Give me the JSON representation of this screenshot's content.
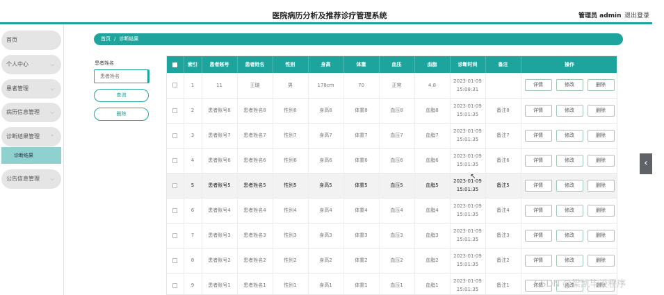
{
  "header": {
    "title": "医院病历分析及推荐诊疗管理系统",
    "admin": "管理员 admin",
    "logout": "退出登录"
  },
  "sidebar": {
    "items": [
      {
        "label": "首页"
      },
      {
        "label": "个人中心"
      },
      {
        "label": "患者管理"
      },
      {
        "label": "病历信息管理"
      },
      {
        "label": "诊断结果管理"
      },
      {
        "label": "公告信息管理"
      }
    ],
    "submenu": "诊断结果"
  },
  "breadcrumb": {
    "home": "首页",
    "sep": "/",
    "current": "诊断结果"
  },
  "search": {
    "label": "患者姓名",
    "placeholder": "患者姓名",
    "query_button": "查询",
    "delete_button": "删除"
  },
  "table": {
    "headers": [
      "索引",
      "患者账号",
      "患者姓名",
      "性别",
      "身高",
      "体重",
      "血压",
      "血脂",
      "诊断时间",
      "备注",
      "操作"
    ],
    "rows": [
      {
        "index": "1",
        "account": "11",
        "name": "王瑞",
        "gender": "男",
        "height": "178cm",
        "weight": "70",
        "bp": "正常",
        "lipid": "4.8",
        "date": "2023-01-09",
        "time": "15:08:31",
        "note": ""
      },
      {
        "index": "2",
        "account": "患者账号8",
        "name": "患者姓名8",
        "gender": "性别8",
        "height": "身高8",
        "weight": "体重8",
        "bp": "血压8",
        "lipid": "血脂8",
        "date": "2023-01-09",
        "time": "15:01:35",
        "note": "备注8"
      },
      {
        "index": "3",
        "account": "患者账号7",
        "name": "患者姓名7",
        "gender": "性别7",
        "height": "身高7",
        "weight": "体重7",
        "bp": "血压7",
        "lipid": "血脂7",
        "date": "2023-01-09",
        "time": "15:01:35",
        "note": "备注7"
      },
      {
        "index": "4",
        "account": "患者账号6",
        "name": "患者姓名6",
        "gender": "性别6",
        "height": "身高6",
        "weight": "体重6",
        "bp": "血压6",
        "lipid": "血脂6",
        "date": "2023-01-09",
        "time": "15:01:35",
        "note": "备注6"
      },
      {
        "index": "5",
        "account": "患者账号5",
        "name": "患者姓名5",
        "gender": "性别5",
        "height": "身高5",
        "weight": "体重5",
        "bp": "血压5",
        "lipid": "血脂5",
        "date": "2023-01-09",
        "time": "15:01:35",
        "note": "备注5"
      },
      {
        "index": "6",
        "account": "患者账号4",
        "name": "患者姓名4",
        "gender": "性别4",
        "height": "身高4",
        "weight": "体重4",
        "bp": "血压4",
        "lipid": "血脂4",
        "date": "2023-01-09",
        "time": "15:01:35",
        "note": "备注4"
      },
      {
        "index": "7",
        "account": "患者账号3",
        "name": "患者姓名3",
        "gender": "性别3",
        "height": "身高3",
        "weight": "体重3",
        "bp": "血压3",
        "lipid": "血脂3",
        "date": "2023-01-09",
        "time": "15:01:35",
        "note": "备注3"
      },
      {
        "index": "8",
        "account": "患者账号2",
        "name": "患者姓名2",
        "gender": "性别2",
        "height": "身高2",
        "weight": "体重2",
        "bp": "血压2",
        "lipid": "血脂2",
        "date": "2023-01-09",
        "time": "15:01:35",
        "note": "备注2"
      },
      {
        "index": "9",
        "account": "患者账号1",
        "name": "患者姓名1",
        "gender": "性别1",
        "height": "身高1",
        "weight": "体重1",
        "bp": "血压1",
        "lipid": "血脂1",
        "date": "2023-01-09",
        "time": "15:01:35",
        "note": "备注1"
      }
    ],
    "actions": {
      "detail": "详情",
      "edit": "修改",
      "delete": "删除"
    }
  },
  "overlay": {
    "collapse_glyph": "‹",
    "watermark": "CSDN @梁凯毕设程序"
  },
  "colors": {
    "accent": "#1da59d",
    "submenu": "#8fd1cf",
    "highlight_row": "#f2f2f2"
  }
}
